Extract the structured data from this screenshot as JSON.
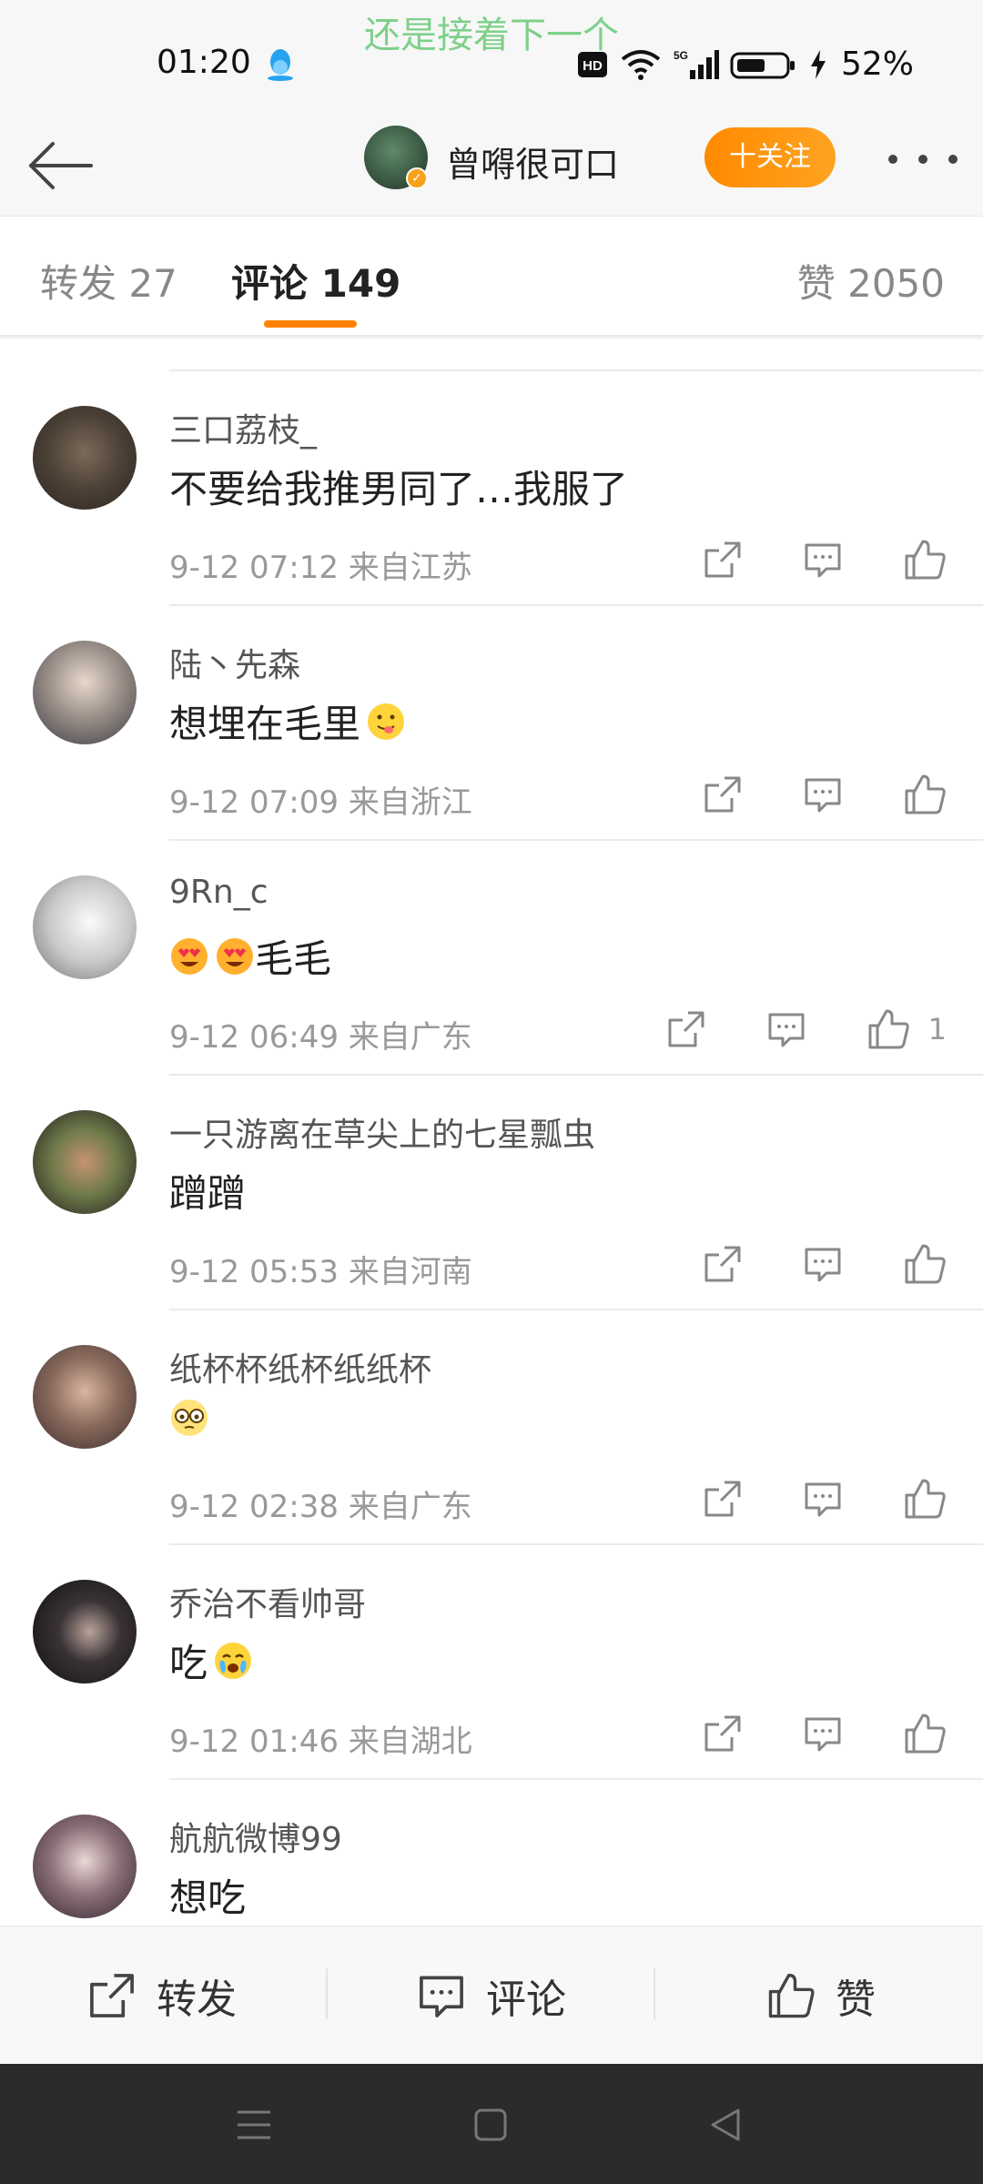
{
  "status_bar": {
    "time": "01:20",
    "overlay_caption": "还是接着下一个",
    "battery_percent": "52%",
    "network": "5G"
  },
  "header": {
    "user_name": "曾嘚很可口",
    "follow_label": "十关注"
  },
  "tabs": [
    {
      "label": "转发 27",
      "active": false
    },
    {
      "label": "评论 149",
      "active": true
    },
    {
      "label": "赞 2050",
      "active": false
    }
  ],
  "comments": [
    {
      "name": "三口荔枝_",
      "text": "不要给我推男同了…我服了",
      "meta": "9-12 07:12  来自江苏",
      "likes": ""
    },
    {
      "name": "陆丶先森",
      "text": "想埋在毛里",
      "meta": "9-12 07:09  来自浙江",
      "likes": ""
    },
    {
      "name": "9Rn_c",
      "text": "毛毛",
      "meta": "9-12 06:49  来自广东",
      "likes": "1"
    },
    {
      "name": "一只游离在草尖上的七星瓢虫",
      "text": "蹭蹭",
      "meta": "9-12 05:53  来自河南",
      "likes": ""
    },
    {
      "name": "纸杯杯纸杯纸纸杯",
      "text": "",
      "meta": "9-12 02:38  来自广东",
      "likes": ""
    },
    {
      "name": "乔治不看帅哥",
      "text": "吃",
      "meta": "9-12 01:46  来自湖北",
      "likes": ""
    },
    {
      "name": "航航微博99",
      "text": "想吃",
      "meta": "",
      "likes": ""
    }
  ],
  "toolbar": {
    "repost_label": "转发",
    "comment_label": "评论",
    "like_label": "赞"
  },
  "colors": {
    "accent": "#ff8200",
    "overlay_text": "#7ed08a"
  }
}
